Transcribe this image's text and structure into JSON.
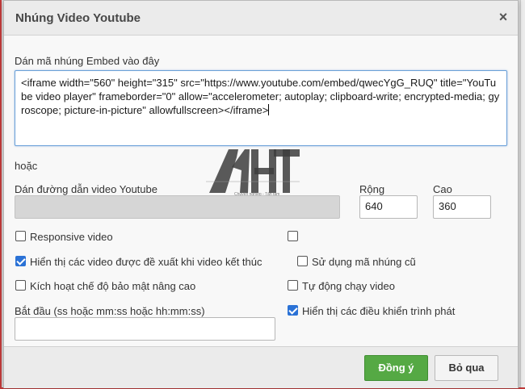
{
  "dialog": {
    "title": "Nhúng Video Youtube",
    "close_symbol": "×"
  },
  "embed": {
    "label": "Dán mã nhúng Embed vào đây",
    "code": "<iframe width=\"560\" height=\"315\" src=\"https://www.youtube.com/embed/qwecYgG_RUQ\" title=\"YouTube video player\" frameborder=\"0\" allow=\"accelerometer; autoplay; clipboard-write; encrypted-media; gyroscope; picture-in-picture\" allowfullscreen></iframe>"
  },
  "or_label": "hoặc",
  "url": {
    "label": "Dán đường dẫn video Youtube",
    "value": ""
  },
  "width": {
    "label": "Rộng",
    "value": "640"
  },
  "height": {
    "label": "Cao",
    "value": "360"
  },
  "options": {
    "responsive": {
      "label": "Responsive video",
      "checked": false
    },
    "unnamed": {
      "label": "",
      "checked": false
    },
    "show_related": {
      "label": "Hiển thị các video được đề xuất khi video kết thúc",
      "checked": true
    },
    "old_embed": {
      "label": "Sử dụng mã nhúng cũ",
      "checked": false
    },
    "privacy": {
      "label": "Kích hoạt chế độ bảo mật nâng cao",
      "checked": false
    },
    "autoplay": {
      "label": "Tự động chạy video",
      "checked": false
    },
    "show_controls": {
      "label": "Hiển thị các điều khiển trình phát",
      "checked": true
    }
  },
  "start": {
    "label": "Bắt đầu (ss hoặc mm:ss hoặc hh:mm:ss)",
    "value": ""
  },
  "buttons": {
    "ok": "Đồng ý",
    "cancel": "Bỏ qua"
  },
  "watermark": {
    "logo_text": "AHT",
    "tagline": "Chuyên nghiệp - Tận tâm"
  },
  "colors": {
    "ok_button": "#55a944",
    "checkbox_checked": "#2b72d6",
    "focus_border": "#6aa0d8"
  }
}
